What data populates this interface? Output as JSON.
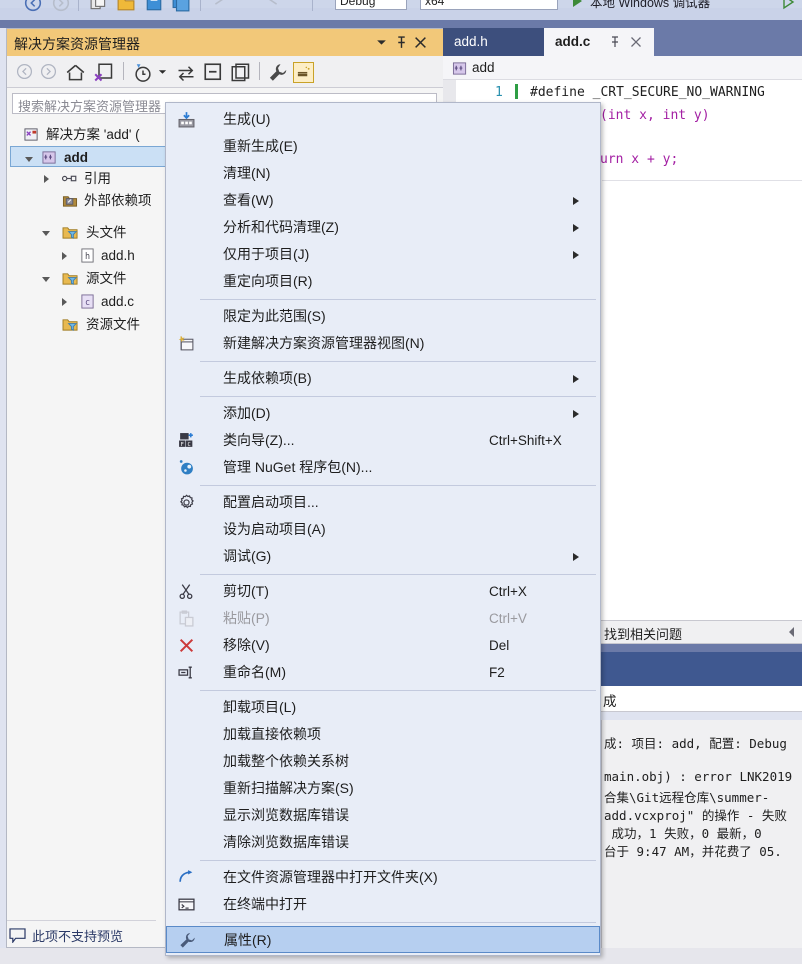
{
  "toolbar": {
    "config_combo": "Debug",
    "platform_combo": "x64",
    "run_label": "本地 Windows 调试器"
  },
  "solution_explorer": {
    "title": "解决方案资源管理器",
    "search_placeholder": "搜索解决方案资源管理器",
    "titlebar_buttons": [
      "chevron-down-icon",
      "pin-icon",
      "close-icon"
    ],
    "toolbar_icons": [
      "back-icon",
      "forward-icon",
      "home-icon",
      "sync-with-active-document-icon",
      "pending-changes-filter-icon",
      "collapse-expand-icon",
      "show-all-files-icon",
      "refresh-icon",
      "properties-wrench-icon",
      "preview-selected-items-icon"
    ],
    "tree": [
      {
        "label": "解决方案 'add' (",
        "depth": 0,
        "twisty": "none",
        "icon": "solution-icon",
        "selected": false
      },
      {
        "label": "add",
        "depth": 1,
        "twisty": "expanded",
        "icon": "cpp-project-icon",
        "selected": true,
        "bold": true
      },
      {
        "label": "引用",
        "depth": 2,
        "twisty": "collapsed",
        "icon": "references-icon",
        "selected": false
      },
      {
        "label": "外部依赖项",
        "depth": 2,
        "twisty": "none",
        "icon": "external-dependencies-icon",
        "selected": false
      },
      {
        "label": "头文件",
        "depth": 2,
        "twisty": "expanded",
        "icon": "filter-folder-icon",
        "selected": false
      },
      {
        "label": "add.h",
        "depth": 3,
        "twisty": "collapsed",
        "icon": "header-file-icon",
        "selected": false
      },
      {
        "label": "源文件",
        "depth": 2,
        "twisty": "expanded",
        "icon": "filter-folder-icon",
        "selected": false
      },
      {
        "label": "add.c",
        "depth": 3,
        "twisty": "collapsed",
        "icon": "c-file-icon",
        "selected": false
      },
      {
        "label": "资源文件",
        "depth": 2,
        "twisty": "none",
        "icon": "filter-folder-icon",
        "selected": false
      }
    ],
    "status_text": "此项不支持预览"
  },
  "editor": {
    "tabs": [
      {
        "label": "add.h",
        "active": false
      },
      {
        "label": "add.c",
        "active": true
      }
    ],
    "nav_scope": "add",
    "line_numbers": [
      "1"
    ],
    "code_lines": [
      "#define _CRT_SECURE_NO_WARNING",
      "(int x, int y)",
      "",
      "urn x + y;"
    ]
  },
  "error_list": {
    "header": "找到相关问题",
    "collapse_icon": "chevron-left-icon"
  },
  "output": {
    "tab_label": "成",
    "lines": [
      "成: 项目: add, 配置: Debug",
      "",
      "main.obj) : error LNK2019",
      "合集\\Git远程仓库\\summer-",
      "add.vcxproj\" 的操作 - 失败",
      " 成功，1 失败，0 最新，0",
      "台于 9:47 AM，并花费了 05."
    ]
  },
  "context_menu": {
    "items": [
      {
        "label": "生成(U)",
        "icon": "build-icon",
        "accel": "",
        "submenu": false,
        "disabled": false,
        "highlight": false,
        "sep_before": false
      },
      {
        "label": "重新生成(E)",
        "icon": "",
        "accel": "",
        "submenu": false,
        "disabled": false,
        "highlight": false,
        "sep_before": false
      },
      {
        "label": "清理(N)",
        "icon": "",
        "accel": "",
        "submenu": false,
        "disabled": false,
        "highlight": false,
        "sep_before": false
      },
      {
        "label": "查看(W)",
        "icon": "",
        "accel": "",
        "submenu": true,
        "disabled": false,
        "highlight": false,
        "sep_before": false
      },
      {
        "label": "分析和代码清理(Z)",
        "icon": "",
        "accel": "",
        "submenu": true,
        "disabled": false,
        "highlight": false,
        "sep_before": false
      },
      {
        "label": "仅用于项目(J)",
        "icon": "",
        "accel": "",
        "submenu": true,
        "disabled": false,
        "highlight": false,
        "sep_before": false
      },
      {
        "label": "重定向项目(R)",
        "icon": "",
        "accel": "",
        "submenu": false,
        "disabled": false,
        "highlight": false,
        "sep_before": false
      },
      {
        "label": "限定为此范围(S)",
        "icon": "",
        "accel": "",
        "submenu": false,
        "disabled": false,
        "highlight": false,
        "sep_before": true
      },
      {
        "label": "新建解决方案资源管理器视图(N)",
        "icon": "new-se-view-icon",
        "accel": "",
        "submenu": false,
        "disabled": false,
        "highlight": false,
        "sep_before": false
      },
      {
        "label": "生成依赖项(B)",
        "icon": "",
        "accel": "",
        "submenu": true,
        "disabled": false,
        "highlight": false,
        "sep_before": true
      },
      {
        "label": "添加(D)",
        "icon": "",
        "accel": "",
        "submenu": true,
        "disabled": false,
        "highlight": false,
        "sep_before": true
      },
      {
        "label": "类向导(Z)...",
        "icon": "class-wizard-icon",
        "accel": "Ctrl+Shift+X",
        "submenu": false,
        "disabled": false,
        "highlight": false,
        "sep_before": false
      },
      {
        "label": "管理 NuGet 程序包(N)...",
        "icon": "nuget-icon",
        "accel": "",
        "submenu": false,
        "disabled": false,
        "highlight": false,
        "sep_before": false
      },
      {
        "label": "配置启动项目...",
        "icon": "gear-icon",
        "accel": "",
        "submenu": false,
        "disabled": false,
        "highlight": false,
        "sep_before": true
      },
      {
        "label": "设为启动项目(A)",
        "icon": "",
        "accel": "",
        "submenu": false,
        "disabled": false,
        "highlight": false,
        "sep_before": false
      },
      {
        "label": "调试(G)",
        "icon": "",
        "accel": "",
        "submenu": true,
        "disabled": false,
        "highlight": false,
        "sep_before": false
      },
      {
        "label": "剪切(T)",
        "icon": "scissors-icon",
        "accel": "Ctrl+X",
        "submenu": false,
        "disabled": false,
        "highlight": false,
        "sep_before": true
      },
      {
        "label": "粘贴(P)",
        "icon": "clipboard-icon",
        "accel": "Ctrl+V",
        "submenu": false,
        "disabled": true,
        "highlight": false,
        "sep_before": false
      },
      {
        "label": "移除(V)",
        "icon": "close-x-icon",
        "accel": "Del",
        "submenu": false,
        "disabled": false,
        "highlight": false,
        "sep_before": false
      },
      {
        "label": "重命名(M)",
        "icon": "rename-icon",
        "accel": "F2",
        "submenu": false,
        "disabled": false,
        "highlight": false,
        "sep_before": false
      },
      {
        "label": "卸载项目(L)",
        "icon": "",
        "accel": "",
        "submenu": false,
        "disabled": false,
        "highlight": false,
        "sep_before": true
      },
      {
        "label": "加载直接依赖项",
        "icon": "",
        "accel": "",
        "submenu": false,
        "disabled": false,
        "highlight": false,
        "sep_before": false
      },
      {
        "label": "加载整个依赖关系树",
        "icon": "",
        "accel": "",
        "submenu": false,
        "disabled": false,
        "highlight": false,
        "sep_before": false
      },
      {
        "label": "重新扫描解决方案(S)",
        "icon": "",
        "accel": "",
        "submenu": false,
        "disabled": false,
        "highlight": false,
        "sep_before": false
      },
      {
        "label": "显示浏览数据库错误",
        "icon": "",
        "accel": "",
        "submenu": false,
        "disabled": false,
        "highlight": false,
        "sep_before": false
      },
      {
        "label": "清除浏览数据库错误",
        "icon": "",
        "accel": "",
        "submenu": false,
        "disabled": false,
        "highlight": false,
        "sep_before": false
      },
      {
        "label": "在文件资源管理器中打开文件夹(X)",
        "icon": "open-folder-arrow-icon",
        "accel": "",
        "submenu": false,
        "disabled": false,
        "highlight": false,
        "sep_before": true
      },
      {
        "label": "在终端中打开",
        "icon": "terminal-icon",
        "accel": "",
        "submenu": false,
        "disabled": false,
        "highlight": false,
        "sep_before": false
      },
      {
        "label": "属性(R)",
        "icon": "properties-wrench-icon",
        "accel": "",
        "submenu": false,
        "disabled": false,
        "highlight": true,
        "sep_before": true
      }
    ]
  },
  "colors": {
    "panel_title_bg": "#f2c879",
    "tab_active_bg": "#f5f5f8",
    "tab_strip_bg": "#6b7aa8",
    "menu_bg": "#e8edf7",
    "menu_highlight": "#b6cff0",
    "tree_selection": "#cbe0f5",
    "code_purple": "#a31fa3",
    "linenum_blue": "#2b91af"
  }
}
